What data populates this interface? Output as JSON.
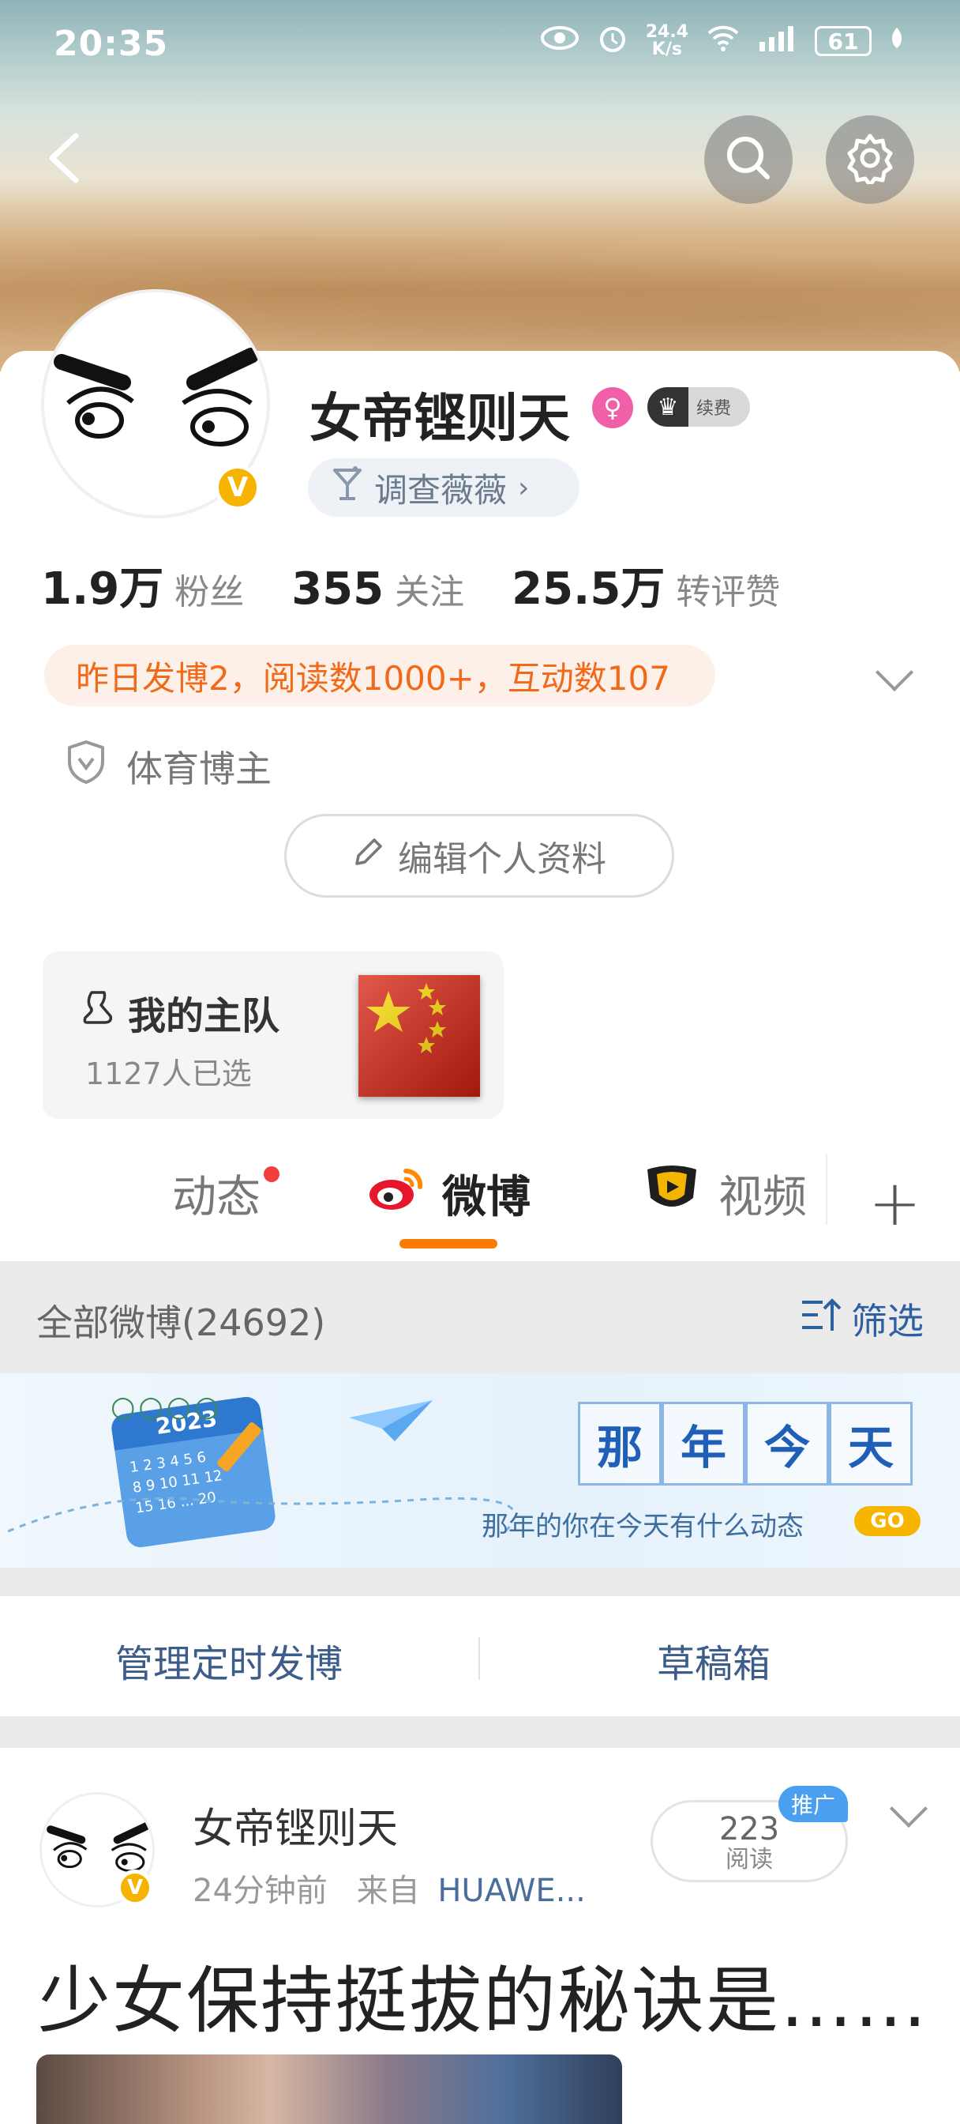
{
  "status_bar": {
    "time": "20:35",
    "net_speed_value": "24.4",
    "net_speed_unit": "K/s",
    "battery": "61",
    "icons": [
      "eye-icon",
      "alarm-icon",
      "wifi-icon",
      "signal-icon",
      "battery-icon",
      "leaf-icon"
    ]
  },
  "header": {
    "back_icon": "back-arrow-icon",
    "search_icon": "search-icon",
    "settings_icon": "gear-icon"
  },
  "profile": {
    "name": "女帝铿则天",
    "vip_label": "续费",
    "tag": "调查薇薇",
    "verified_badge": "V",
    "stats": [
      {
        "value": "1.9万",
        "label": "粉丝"
      },
      {
        "value": "355",
        "label": "关注"
      },
      {
        "value": "25.5万",
        "label": "转评赞"
      }
    ],
    "notice": "昨日发博2，阅读数1000+，互动数107",
    "category": "体育博主",
    "edit_button": "编辑个人资料"
  },
  "team": {
    "title": "我的主队",
    "subtitle": "1127人已选"
  },
  "tabs": [
    {
      "label": "动态",
      "active": false,
      "dot": true
    },
    {
      "label": "微博",
      "active": true
    },
    {
      "label": "视频",
      "active": false
    }
  ],
  "tabs_add": "+",
  "filter_bar": {
    "all_posts": "全部微博(24692)",
    "filter": "筛选"
  },
  "banner": {
    "calendar_year": "2023",
    "calendar_days": [
      "1 2 3 4 5 6",
      "8 9 10 11 12",
      "15 16 ... 20"
    ],
    "chars": [
      "那",
      "年",
      "今",
      "天"
    ],
    "subtitle": "那年的你在今天有什么动态",
    "go": "GO"
  },
  "manage": {
    "scheduled": "管理定时发博",
    "drafts": "草稿箱"
  },
  "post": {
    "author": "女帝铿则天",
    "time": "24分钟前",
    "source_prefix": "来自",
    "source": "HUAWE...",
    "reads_count": "223",
    "reads_label": "阅读",
    "promo_label": "推广",
    "text": "少女保持挺拔的秘诀是……"
  },
  "colors": {
    "accent_orange": "#ff7a00",
    "link_blue": "#2d5fa2",
    "notice_orange": "#f06a1a",
    "verified_gold": "#f6b400"
  }
}
